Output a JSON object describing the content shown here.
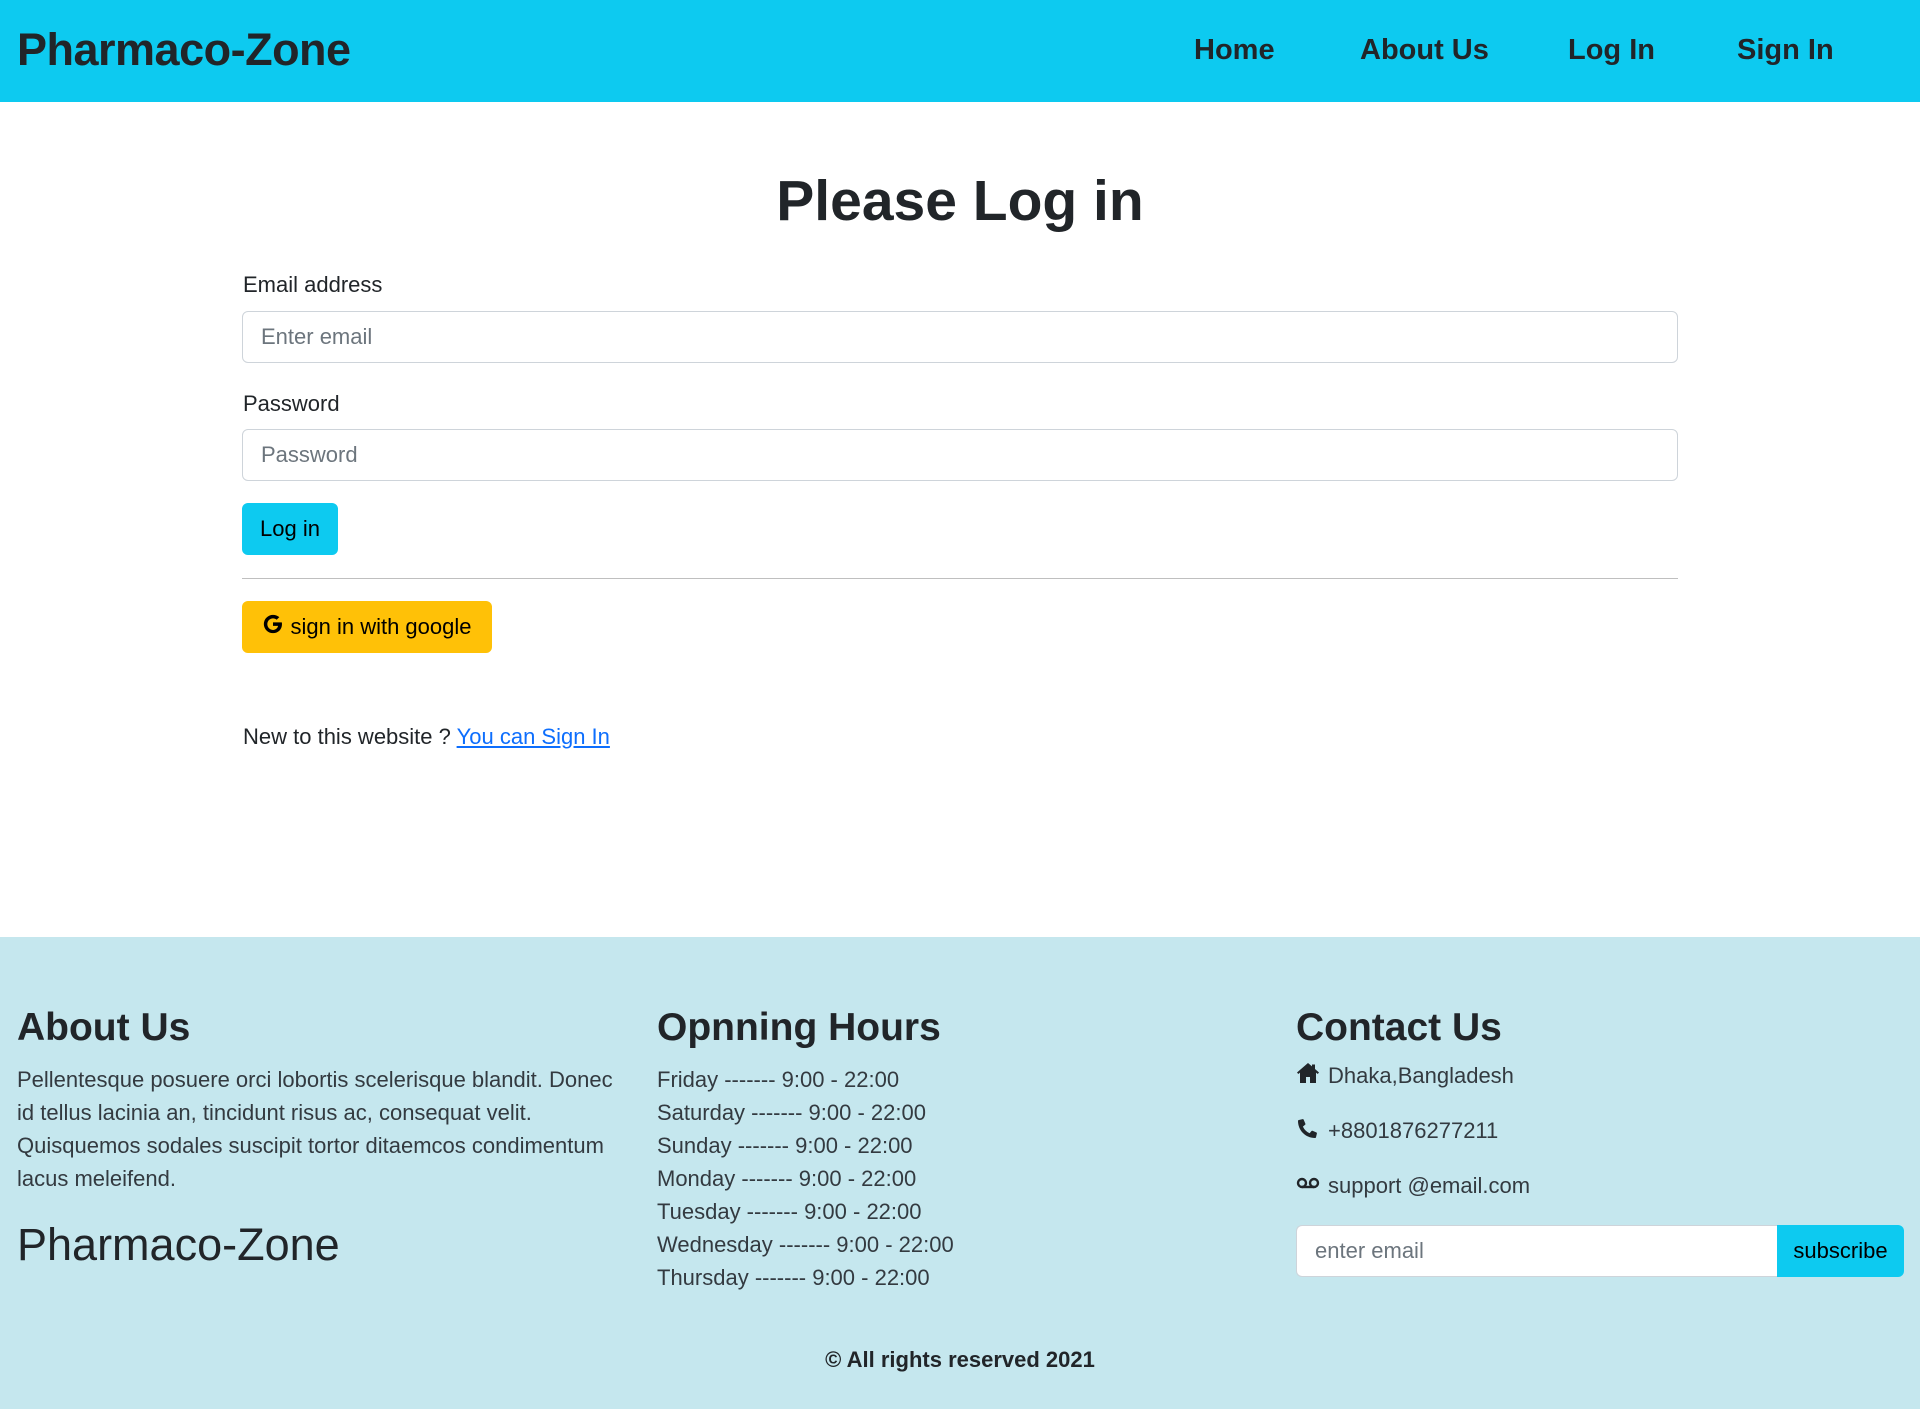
{
  "navbar": {
    "brand": "Pharmaco-Zone",
    "links": [
      "Home",
      "About Us",
      "Log In",
      "Sign In"
    ],
    "bg_color": "#0dcaf0"
  },
  "login": {
    "title": "Please Log in",
    "email_label": "Email address",
    "email_placeholder": "Enter email",
    "password_label": "Password",
    "password_placeholder": "Password",
    "login_button": "Log in",
    "google_button": "sign in with google",
    "signup_prompt": "New to this website ?",
    "signup_link": "You can Sign In"
  },
  "footer": {
    "bg_color": "#c5e7ee",
    "about_heading": "About Us",
    "about_text": "Pellentesque posuere orci lobortis scelerisque blandit. Donec id tellus lacinia an, tincidunt risus ac, consequat velit. Quisquemos sodales suscipit tortor ditaemcos condimentum lacus meleifend.",
    "brand": "Pharmaco-Zone",
    "hours_heading": "Opnning Hours",
    "hours": [
      "Friday ------- 9:00 - 22:00",
      "Saturday ------- 9:00 - 22:00",
      "Sunday ------- 9:00 - 22:00",
      "Monday ------- 9:00 - 22:00",
      "Tuesday ------- 9:00 - 22:00",
      "Wednesday ------- 9:00 - 22:00",
      "Thursday ------- 9:00 - 22:00"
    ],
    "contact_heading": "Contact Us",
    "address": "Dhaka,Bangladesh",
    "phone": "+8801876277211",
    "email": "support @email.com",
    "subscribe_placeholder": "enter email",
    "subscribe_button": "subscribe",
    "copyright": "© All rights reserved 2021"
  }
}
